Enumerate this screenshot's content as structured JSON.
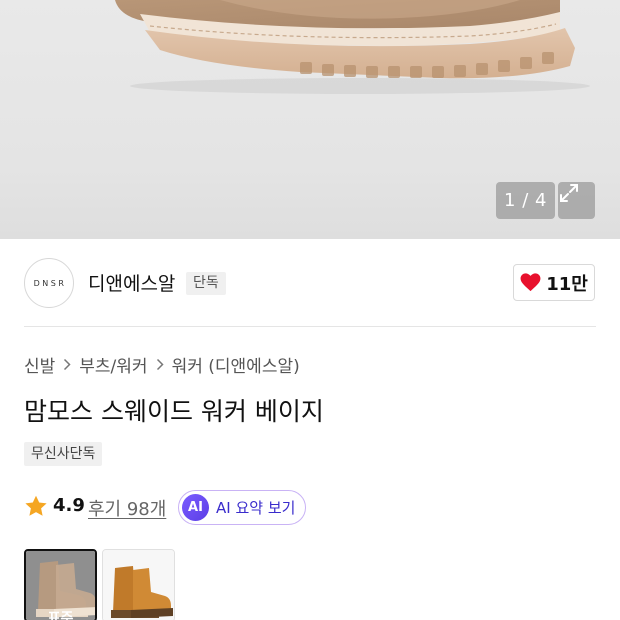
{
  "gallery": {
    "counter": "1 / 4",
    "expand_icon": "expand-icon"
  },
  "brand": {
    "logo_text": "DNSR",
    "name": "디앤에스알",
    "badge": "단독"
  },
  "like": {
    "icon": "heart-icon",
    "color": "#e8112d",
    "count": "11만"
  },
  "breadcrumb": {
    "items": [
      "신발",
      "부츠/워커",
      "워커 (디앤에스알)"
    ]
  },
  "product": {
    "title": "맘모스 스웨이드 워커 베이지",
    "store_badge": "무신사단독"
  },
  "rating": {
    "star_color": "#f5a623",
    "score": "4.9",
    "reviews": "후기 98개"
  },
  "ai_summary": {
    "badge": "AI",
    "label": "AI 요약 보기",
    "accent": "#5b3ee6"
  },
  "variants": [
    {
      "label": "표준",
      "color": "beige",
      "selected": true
    },
    {
      "label": "",
      "color": "tan",
      "selected": false
    }
  ]
}
